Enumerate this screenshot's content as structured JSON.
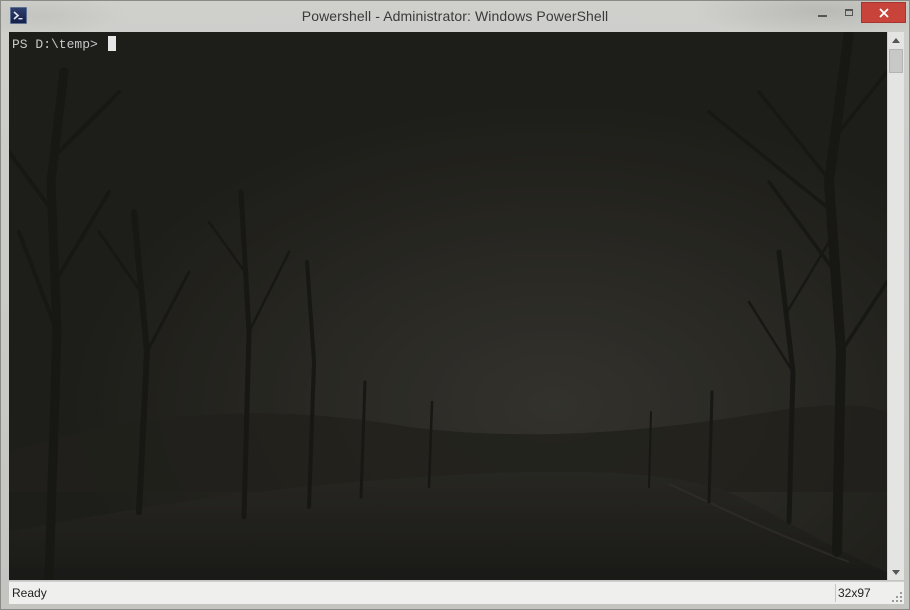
{
  "window": {
    "title": "Powershell - Administrator: Windows PowerShell",
    "app_icon": "powershell-icon",
    "buttons": {
      "minimize": "minimize-icon",
      "maximize": "maximize-icon",
      "close": "close-icon"
    }
  },
  "console": {
    "prompt": "PS D:\\temp> ",
    "background": "misty-forest-road",
    "text_color": "#c8c8c8"
  },
  "statusbar": {
    "status": "Ready",
    "size": "32x97"
  },
  "colors": {
    "close_button": "#c8443a",
    "console_bg": "#24241f",
    "frame": "#c9c9c6"
  }
}
